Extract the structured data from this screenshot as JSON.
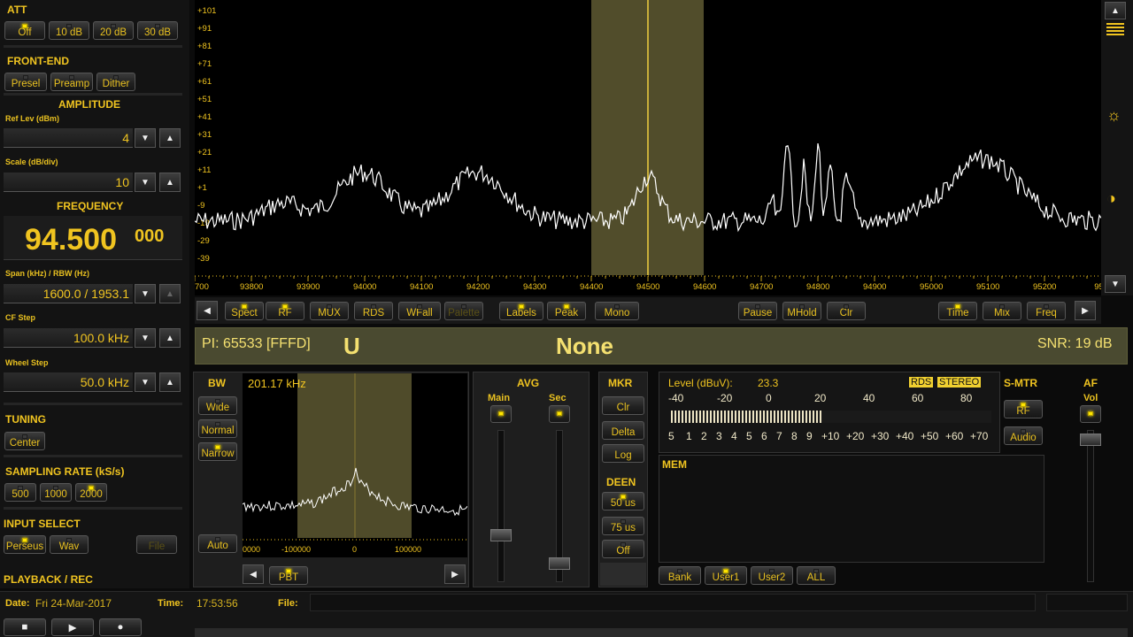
{
  "att": {
    "title": "ATT",
    "buttons": [
      {
        "label": "Off",
        "on": true
      },
      {
        "label": "10 dB",
        "on": false
      },
      {
        "label": "20 dB",
        "on": false
      },
      {
        "label": "30 dB",
        "on": false
      }
    ]
  },
  "front_end": {
    "title": "FRONT-END",
    "buttons": [
      {
        "label": "Presel",
        "on": false
      },
      {
        "label": "Preamp",
        "on": false
      },
      {
        "label": "Dither",
        "on": false
      }
    ]
  },
  "amplitude": {
    "title": "AMPLITUDE",
    "ref_lev_label": "Ref Lev (dBm)",
    "ref_lev_value": "4",
    "scale_label": "Scale (dB/div)",
    "scale_value": "10"
  },
  "frequency": {
    "title": "FREQUENCY",
    "main": "94.500",
    "fine": "000",
    "span_label": "Span (kHz) / RBW (Hz)",
    "span_value": "1600.0 / 1953.1",
    "cf_step_label": "CF Step",
    "cf_step_value": "100.0 kHz",
    "wheel_step_label": "Wheel Step",
    "wheel_step_value": "50.0 kHz"
  },
  "tuning": {
    "title": "TUNING",
    "center_label": "Center"
  },
  "sampling": {
    "title": "SAMPLING RATE (kS/s)",
    "buttons": [
      {
        "label": "500",
        "on": false
      },
      {
        "label": "1000",
        "on": false
      },
      {
        "label": "2000",
        "on": true
      }
    ]
  },
  "input_select": {
    "title": "INPUT SELECT",
    "buttons": [
      {
        "label": "Perseus",
        "on": true
      },
      {
        "label": "Wav",
        "on": false
      }
    ],
    "file_label": "File"
  },
  "playback": {
    "title": "PLAYBACK / REC"
  },
  "status": {
    "date_label": "Date:",
    "date_value": "Fri 24-Mar-2017",
    "time_label": "Time:",
    "time_value": "17:53:56",
    "file_label": "File:"
  },
  "spectrum": {
    "y_labels": [
      "+101",
      "+91",
      "+81",
      "+71",
      "+61",
      "+51",
      "+41",
      "+31",
      "+21",
      "+11",
      "+1",
      "-9",
      "-19",
      "-29",
      "-39"
    ],
    "x_labels": [
      "700",
      "93800",
      "93900",
      "94000",
      "94100",
      "94200",
      "94300",
      "94400",
      "94500",
      "94600",
      "94700",
      "94800",
      "94900",
      "95000",
      "95100",
      "95200",
      "953"
    ],
    "toolbar": [
      {
        "label": "Spect",
        "on": true
      },
      {
        "label": "RF",
        "on": true
      },
      {
        "label": "MUX",
        "on": false
      },
      {
        "label": "RDS",
        "on": false
      },
      {
        "label": "WFall",
        "on": false
      },
      {
        "label": "Palette",
        "on": false,
        "dim": true
      },
      {
        "label": "Labels",
        "on": true
      },
      {
        "label": "Peak",
        "on": true
      },
      {
        "label": "Mono",
        "on": false
      },
      {
        "label": "Pause",
        "on": false
      },
      {
        "label": "MHold",
        "on": false
      },
      {
        "label": "Clr",
        "on": false
      },
      {
        "label": "Time",
        "on": true
      },
      {
        "label": "Mix",
        "on": false
      },
      {
        "label": "Freq",
        "on": false
      }
    ]
  },
  "rds": {
    "pi": "PI: 65533 [FFFD]",
    "pty": "U",
    "ps": "None",
    "snr": "SNR: 19 dB"
  },
  "bw": {
    "title": "BW",
    "readout": "201.17 kHz",
    "buttons": [
      {
        "label": "Wide",
        "on": false
      },
      {
        "label": "Normal",
        "on": false
      },
      {
        "label": "Narrow",
        "on": true
      },
      {
        "label": "Auto",
        "on": false
      }
    ],
    "x_labels": [
      "0000",
      "-100000",
      "0",
      "100000"
    ],
    "pbt_label": "PBT"
  },
  "avg": {
    "title": "AVG",
    "main_label": "Main",
    "sec_label": "Sec"
  },
  "mkr": {
    "title": "MKR",
    "buttons": [
      "Clr",
      "Delta",
      "Log"
    ]
  },
  "deen": {
    "title": "DEEN",
    "buttons": [
      {
        "label": "50 us",
        "on": true
      },
      {
        "label": "75 us",
        "on": false
      },
      {
        "label": "Off",
        "on": false
      }
    ]
  },
  "level": {
    "label": "Level (dBuV):",
    "value": "23.3",
    "rds_badge": "RDS",
    "stereo_badge": "STEREO",
    "scale_top": [
      "-40",
      "-20",
      "0",
      "20",
      "40",
      "60",
      "80"
    ],
    "scale_bottom": [
      "5",
      "1",
      "2",
      "3",
      "4",
      "5",
      "6",
      "7",
      "8",
      "9",
      "+10",
      "+20",
      "+30",
      "+40",
      "+50",
      "+60",
      "+70"
    ],
    "bar_fraction": 0.47
  },
  "smtr": {
    "title": "S-MTR",
    "buttons": [
      {
        "label": "RF",
        "on": true
      },
      {
        "label": "Audio",
        "on": false
      }
    ]
  },
  "af": {
    "title": "AF",
    "vol_label": "Vol"
  },
  "mem": {
    "title": "MEM",
    "buttons": [
      {
        "label": "Bank",
        "on": false
      },
      {
        "label": "User1",
        "on": true
      },
      {
        "label": "User2",
        "on": false
      },
      {
        "label": "ALL",
        "on": false
      }
    ]
  }
}
